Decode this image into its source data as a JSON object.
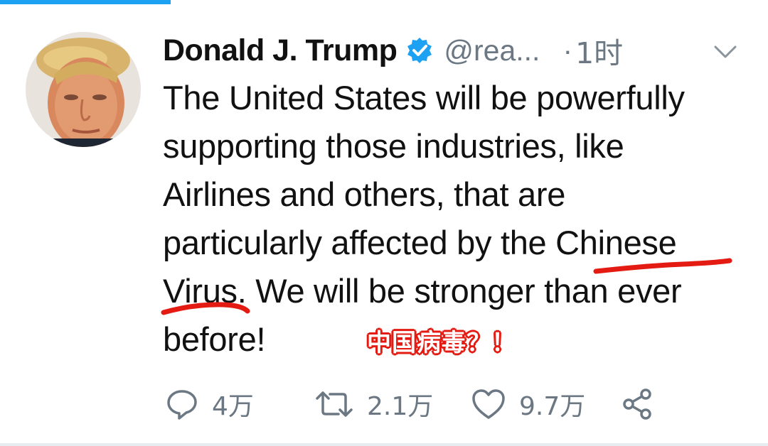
{
  "tweet": {
    "author": {
      "display_name": "Donald J. Trump",
      "handle": "@rea...",
      "verified": true
    },
    "separator": "·",
    "time": "1时",
    "text_lines": [
      "The United States will be powerfully",
      "supporting those industries, like",
      "Airlines and others, that are",
      "particularly affected by the Chinese",
      "Virus. We will be stronger than ever",
      "before!"
    ],
    "actions": {
      "reply": {
        "icon": "reply-icon",
        "count": "4万"
      },
      "retweet": {
        "icon": "retweet-icon",
        "count": "2.1万"
      },
      "like": {
        "icon": "heart-icon",
        "count": "9.7万"
      },
      "share": {
        "icon": "share-icon"
      }
    },
    "menu_icon": "chevron-down-icon"
  },
  "annotation": {
    "note": "中国病毒？！",
    "color": "#e31b12"
  },
  "colors": {
    "accent": "#1da1f2",
    "verified_badge": "#1da1f2",
    "muted_text": "#6b7782",
    "annotation_red": "#e31b12"
  }
}
